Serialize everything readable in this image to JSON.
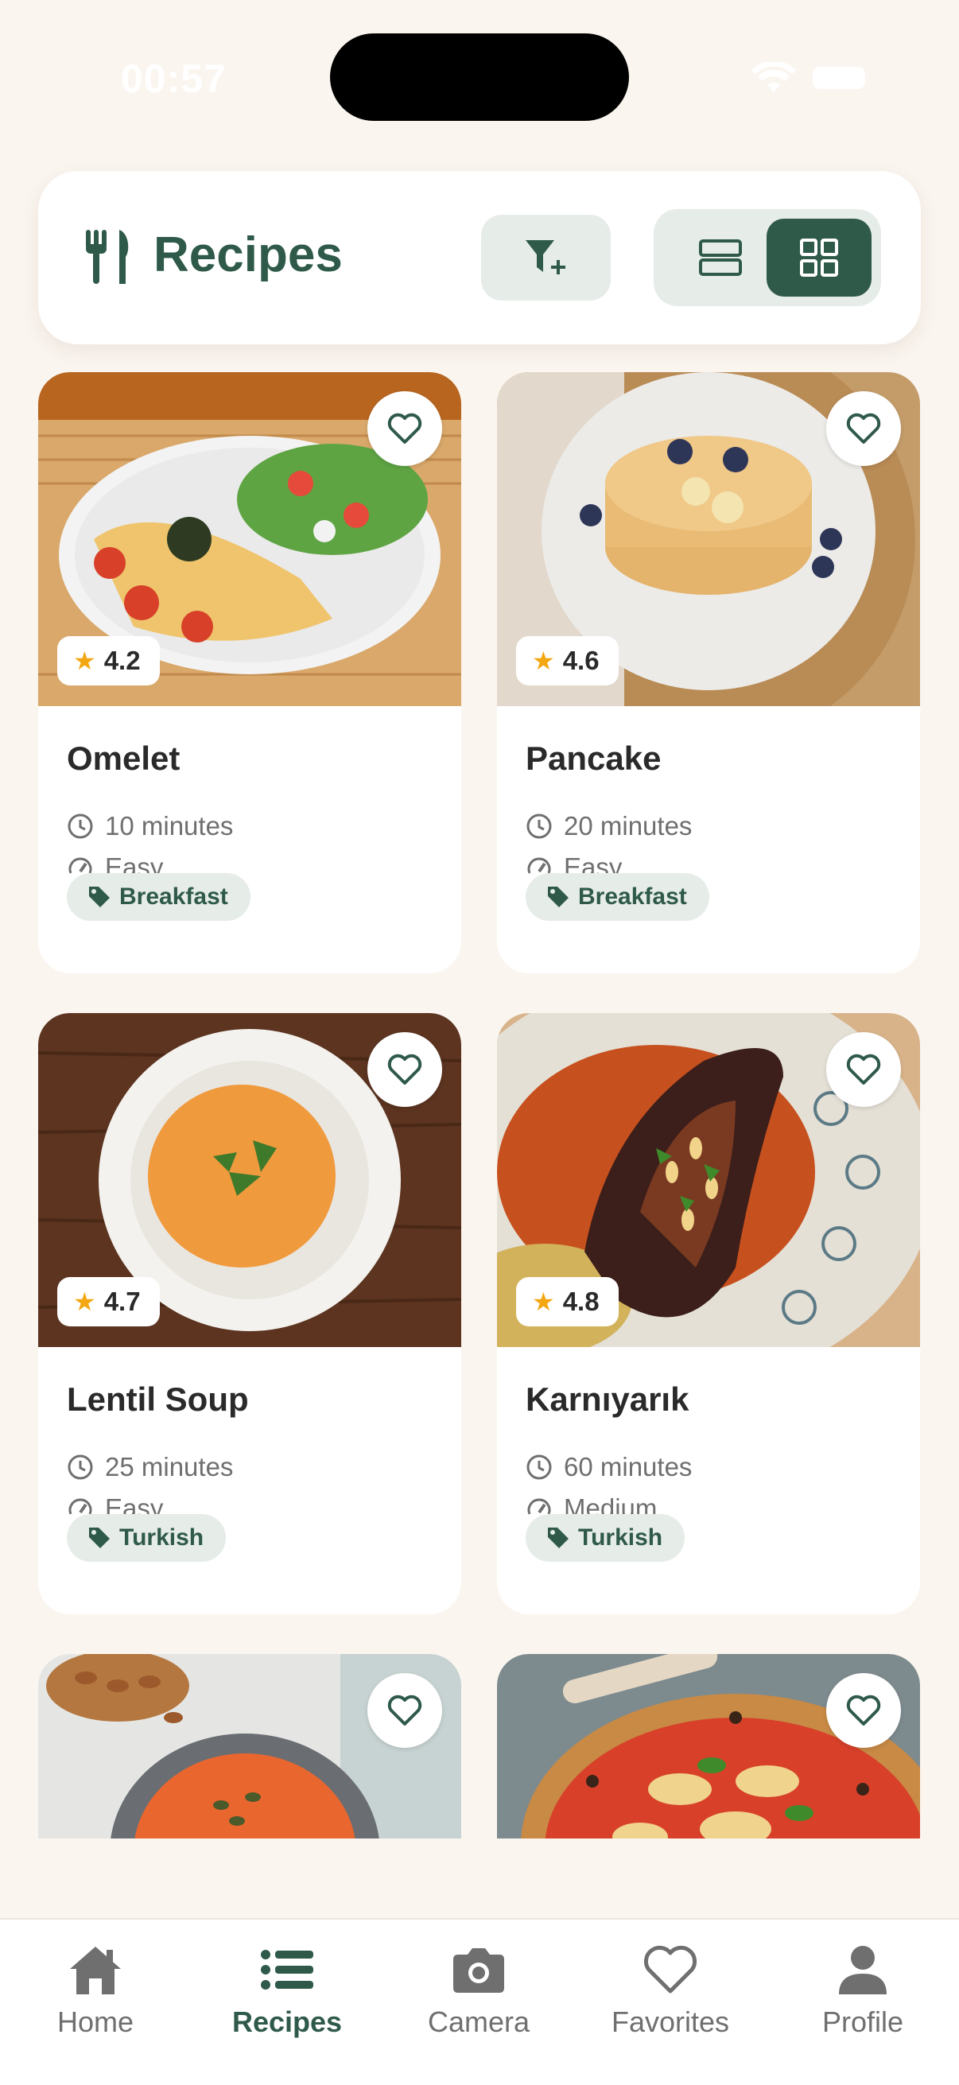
{
  "status": {
    "time": "00:57"
  },
  "header": {
    "title": "Recipes"
  },
  "colors": {
    "accent": "#2f5a4a",
    "star": "#f3a712",
    "background": "#fbf5ef"
  },
  "recipes": [
    {
      "name": "Omelet",
      "rating": "4.2",
      "time": "10 minutes",
      "difficulty": "Easy",
      "tag": "Breakfast"
    },
    {
      "name": "Pancake",
      "rating": "4.6",
      "time": "20 minutes",
      "difficulty": "Easy",
      "tag": "Breakfast"
    },
    {
      "name": "Lentil Soup",
      "rating": "4.7",
      "time": "25 minutes",
      "difficulty": "Easy",
      "tag": "Turkish"
    },
    {
      "name": "Karnıyarık",
      "rating": "4.8",
      "time": "60 minutes",
      "difficulty": "Medium",
      "tag": "Turkish"
    }
  ],
  "nav": [
    {
      "label": "Home",
      "icon": "home-icon"
    },
    {
      "label": "Recipes",
      "icon": "list-icon",
      "active": true
    },
    {
      "label": "Camera",
      "icon": "camera-icon"
    },
    {
      "label": "Favorites",
      "icon": "heart-icon"
    },
    {
      "label": "Profile",
      "icon": "person-icon"
    }
  ]
}
